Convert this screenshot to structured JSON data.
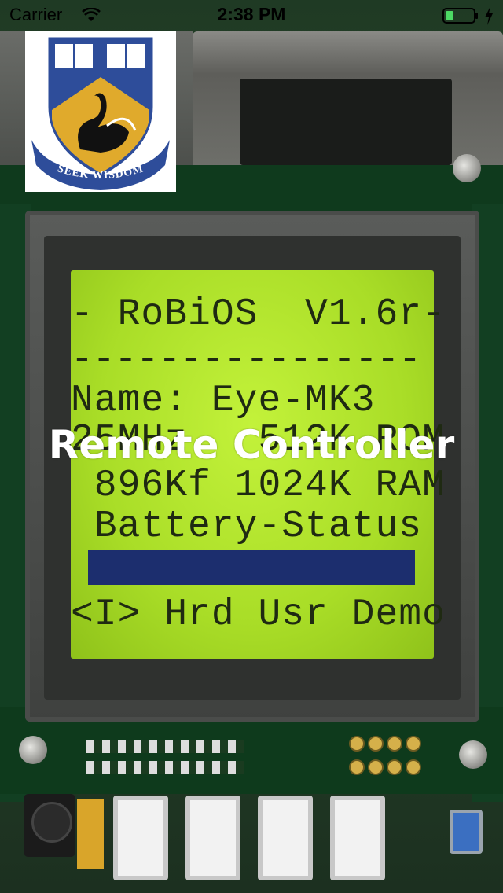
{
  "status_bar": {
    "carrier": "Carrier",
    "time": "2:38 PM",
    "icons": [
      "wifi-icon",
      "battery-icon",
      "charging-bolt-icon"
    ],
    "battery_color": "#4cd964"
  },
  "logo": {
    "motto": "SEEK WISDOM",
    "shield_color": "#2e4d9a",
    "swan_field_color": "#e0aa2c"
  },
  "title": "Remote Controller",
  "lcd": {
    "lines": [
      "- RoBiOS  V1.6r-",
      "----------------",
      "Name: Eye-MK3",
      "25MHz   512K ROM",
      " 896Kf 1024K RAM",
      " Battery-Status",
      "",
      "<I> Hrd Usr Demo"
    ],
    "battery_fill": 1.0
  },
  "colors": {
    "lcd_background": "#b4e52d",
    "lcd_text": "#1f2a12",
    "title_text": "#ffffff"
  }
}
